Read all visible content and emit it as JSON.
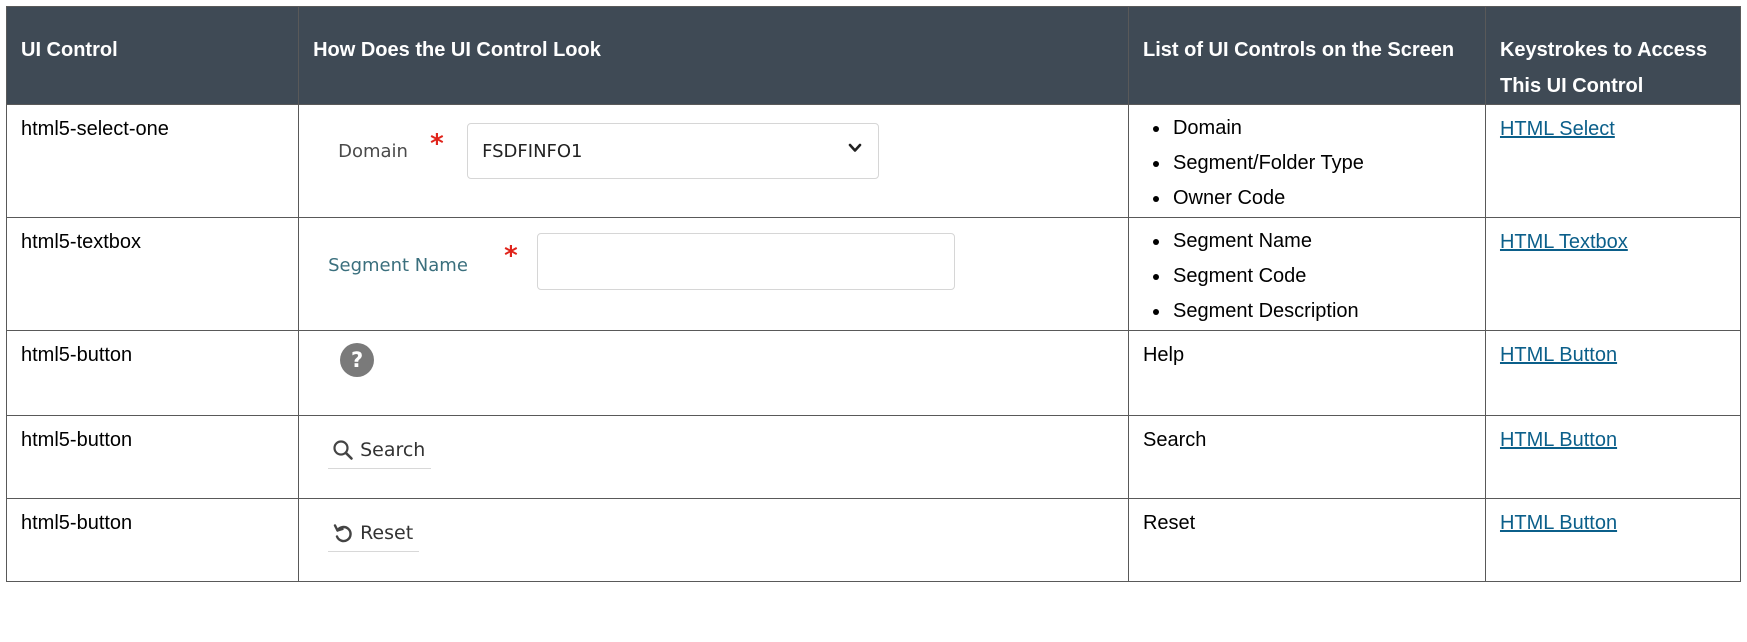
{
  "headers": {
    "ui_control": "UI Control",
    "look": "How Does the UI Control Look",
    "list": "List of UI Controls on the Screen",
    "keystrokes": "Keystrokes to Access This UI Control"
  },
  "rows": [
    {
      "control": "html5-select-one",
      "widget": {
        "label": "Domain",
        "required_mark": "*",
        "value": "FSDFINFO1"
      },
      "list": [
        "Domain",
        "Segment/Folder Type",
        "Owner Code"
      ],
      "link": "HTML Select"
    },
    {
      "control": "html5-textbox",
      "widget": {
        "label": "Segment Name",
        "required_mark": "*",
        "value": ""
      },
      "list": [
        "Segment Name",
        "Segment Code",
        "Segment Description"
      ],
      "link": "HTML Textbox"
    },
    {
      "control": "html5-button",
      "widget": {
        "glyph": "?",
        "icon": "help-icon"
      },
      "list_text": "Help",
      "link": "HTML Button"
    },
    {
      "control": "html5-button",
      "widget": {
        "label": "Search",
        "icon": "search-icon"
      },
      "list_text": "Search",
      "link": "HTML Button"
    },
    {
      "control": "html5-button",
      "widget": {
        "label": "Reset",
        "icon": "reset-icon"
      },
      "list_text": "Reset",
      "link": "HTML Button"
    }
  ],
  "colors": {
    "header_bg": "#3f4a55",
    "header_text": "#ffffff",
    "link": "#0b5f8a",
    "required": "#e0241b",
    "border": "#595959"
  }
}
